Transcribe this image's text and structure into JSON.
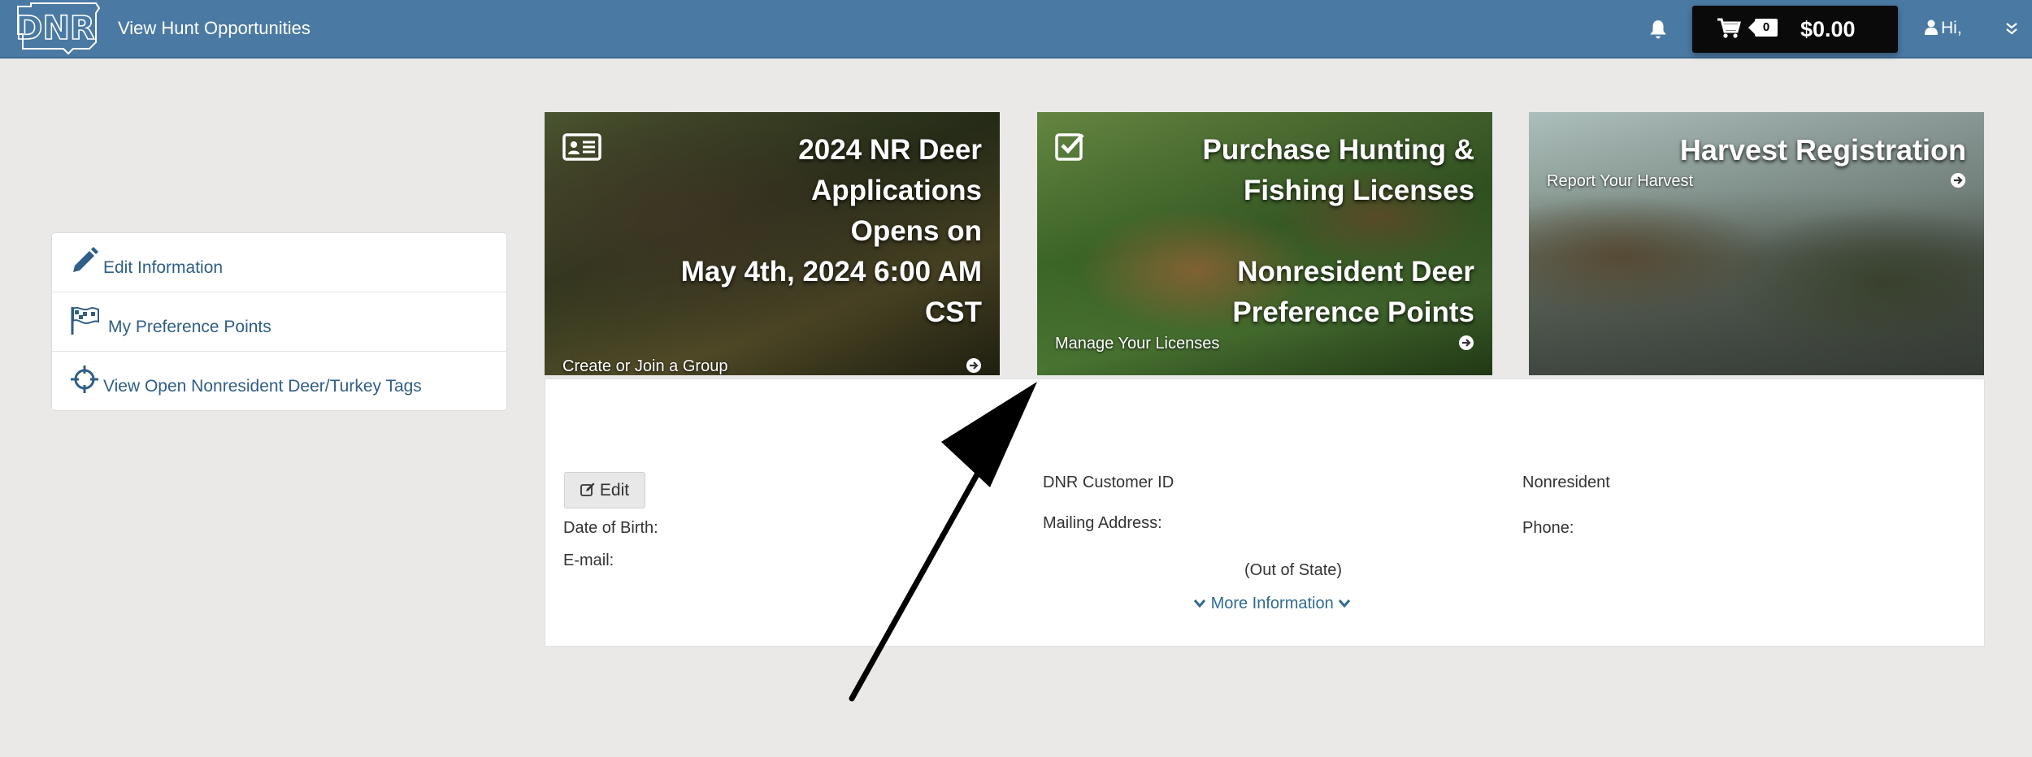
{
  "header": {
    "logo_text": "DNR",
    "nav_link": "View Hunt Opportunities",
    "cart_count": "0",
    "cart_total": "$0.00",
    "user_greeting": "Hi,"
  },
  "sidebar": {
    "items": [
      {
        "label": "Edit Information",
        "icon": "pencil-icon"
      },
      {
        "label": "My Preference Points",
        "icon": "flag-icon"
      },
      {
        "label": "View Open Nonresident Deer/Turkey Tags",
        "icon": "crosshairs-icon"
      }
    ]
  },
  "tiles": [
    {
      "title_lines": [
        "2024 NR Deer",
        "Applications",
        "Opens on",
        "May 4th, 2024 6:00 AM",
        "CST"
      ],
      "cta": "Create or Join a Group",
      "icon": "id-card-icon"
    },
    {
      "title_lines": [
        "Purchase Hunting &",
        "Fishing Licenses"
      ],
      "sub_lines": [
        "Nonresident Deer",
        "Preference Points"
      ],
      "cta": "Manage Your Licenses",
      "icon": "checkbox-icon"
    },
    {
      "title_lines": [
        "Harvest Registration"
      ],
      "cta": "Report Your Harvest"
    }
  ],
  "profile": {
    "edit_label": "Edit",
    "dob_label": "Date of Birth:",
    "email_label": "E-mail:",
    "customer_id_label": "DNR Customer ID",
    "mailing_label": "Mailing Address:",
    "out_of_state": "(Out of State)",
    "residency": "Nonresident",
    "phone_label": "Phone:",
    "more_info": "More Information"
  },
  "colors": {
    "header_bg": "#4a7aa3",
    "link": "#2f5e86",
    "cart_bg": "#0a0a0a",
    "page_bg": "#eae9e7"
  }
}
